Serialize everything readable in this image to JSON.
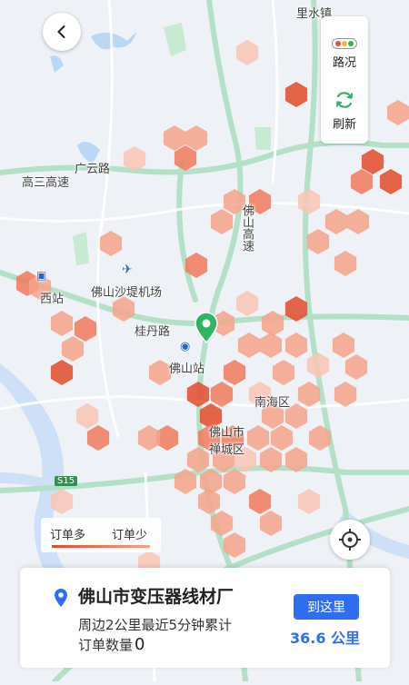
{
  "map": {
    "labels": {
      "lishuizhen": "里水镇",
      "guangyunlu": "广云路",
      "gaosangaosu": "高三高速",
      "foshangaosu": "佛山高速",
      "shadiairport": "佛山沙堤机场",
      "guidanlu": "桂丹路",
      "foshanstation": "佛山站",
      "nanhaiqu": "南海区",
      "foshanshi": "佛山市",
      "chanchengqu": "禅城区",
      "xizhan": "西站",
      "s15": "S15"
    },
    "heat_colors": [
      "#e24b2a",
      "#ee7a5c",
      "#f4a38b",
      "#f8c4b3"
    ]
  },
  "controls": {
    "back_icon": "chevron-left-icon",
    "traffic_label": "路况",
    "refresh_label": "刷新",
    "locate_icon": "crosshair-icon"
  },
  "legend": {
    "more_label": "订单多",
    "less_label": "订单少"
  },
  "card": {
    "place_name": "佛山市变压器线材厂",
    "desc_line1": "周边2公里最近5分钟累计",
    "desc_line2": "订单数量",
    "order_count": "0",
    "go_button": "到这里",
    "distance": "36.6 公里",
    "accent_color": "#2f6ef0"
  }
}
